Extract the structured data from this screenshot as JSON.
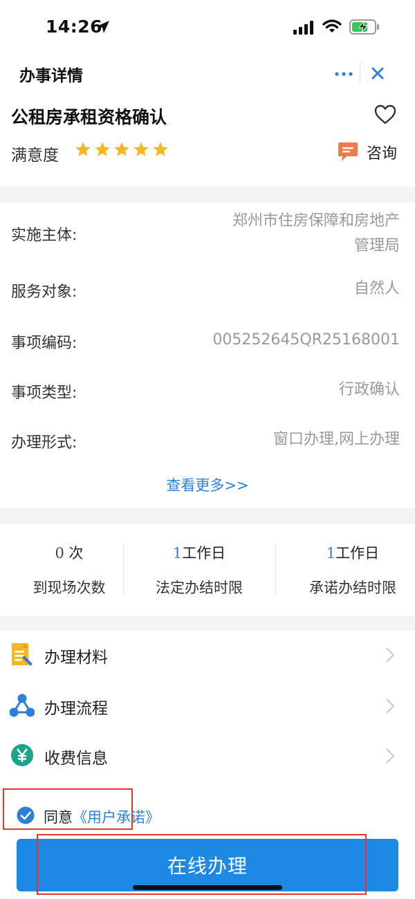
{
  "status_bar": {
    "time": "14:26"
  },
  "nav": {
    "title": "办事详情"
  },
  "service": {
    "title": "公租房承租资格确认",
    "satisfaction_label": "满意度",
    "stars": 5,
    "consult_label": "咨询"
  },
  "info": {
    "rows": [
      {
        "label": "实施主体:",
        "value_line1": "郑州市住房保障和房地产",
        "value_line2": "管理局"
      },
      {
        "label": "服务对象:",
        "value": "自然人"
      },
      {
        "label": "事项编码:",
        "value": "005252645QR25168001"
      },
      {
        "label": "事项类型:",
        "value": "行政确认"
      },
      {
        "label": "办理形式:",
        "value": "窗口办理,网上办理"
      }
    ],
    "see_more": "查看更多>>"
  },
  "stats": [
    {
      "number": "0",
      "unit": " 次",
      "label": "到现场次数"
    },
    {
      "number": "1",
      "unit": "工作日",
      "label": "法定办结时限"
    },
    {
      "number": "1",
      "unit": "工作日",
      "label": "承诺办结时限"
    }
  ],
  "menu": [
    {
      "label": "办理材料",
      "icon": "document-icon"
    },
    {
      "label": "办理流程",
      "icon": "process-icon"
    },
    {
      "label": "收费信息",
      "icon": "yen-icon"
    }
  ],
  "agreement": {
    "prefix": "同意",
    "link": "《用户承诺》",
    "checked": true
  },
  "button": {
    "label": "在线办理"
  },
  "colors": {
    "accent": "#1e88e5",
    "link": "#2d80d8",
    "star": "#f5b820",
    "highlight": "#e8342f"
  }
}
